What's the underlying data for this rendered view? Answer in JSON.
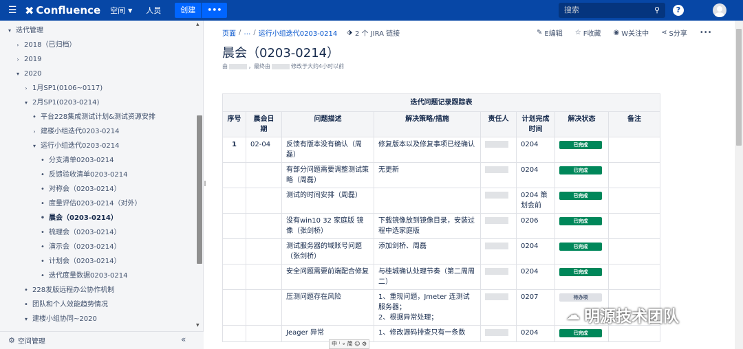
{
  "header": {
    "app_name": "Confluence",
    "nav_spaces": "空间",
    "nav_people": "人员",
    "create_label": "创建",
    "more_label": "•••",
    "search_placeholder": "搜索",
    "help_label": "?"
  },
  "sidebar": {
    "items": [
      {
        "label": "迭代管理",
        "level": 0,
        "expander": "▾"
      },
      {
        "label": "2018（已归档）",
        "level": 1,
        "expander": "›"
      },
      {
        "label": "2019",
        "level": 1,
        "expander": "›"
      },
      {
        "label": "2020",
        "level": 1,
        "expander": "▾"
      },
      {
        "label": "1月SP1(0106~0117)",
        "level": 2,
        "expander": "›"
      },
      {
        "label": "2月SP1(0203-0214)",
        "level": 2,
        "expander": "▾"
      },
      {
        "label": "平台228集成测试计划&测试资源安排",
        "level": 3,
        "expander": "•"
      },
      {
        "label": "建楼小组迭代0203-0214",
        "level": 3,
        "expander": "›"
      },
      {
        "label": "运行小组迭代0203-0214",
        "level": 3,
        "expander": "▾"
      },
      {
        "label": "分支清单0203-0214",
        "level": 4,
        "expander": "•"
      },
      {
        "label": "反馈验收清单0203-0214",
        "level": 4,
        "expander": "•"
      },
      {
        "label": "对称会（0203-0214）",
        "level": 4,
        "expander": "•"
      },
      {
        "label": "度量评估0203-0214（对外）",
        "level": 4,
        "expander": "•"
      },
      {
        "label": "晨会（0203-0214）",
        "level": 4,
        "expander": "•",
        "active": true
      },
      {
        "label": "梳理会（0203-0214）",
        "level": 4,
        "expander": "•"
      },
      {
        "label": "演示会（0203-0214）",
        "level": 4,
        "expander": "•"
      },
      {
        "label": "计划会（0203-0214）",
        "level": 4,
        "expander": "•"
      },
      {
        "label": "迭代度量数据0203-0214",
        "level": 4,
        "expander": "•"
      },
      {
        "label": "228发版远程办公协作机制",
        "level": 2,
        "expander": "•"
      },
      {
        "label": "团队和个人效能趋势情况",
        "level": 2,
        "expander": "•"
      },
      {
        "label": "建楼小组协同~2020",
        "level": 2,
        "expander": "▾"
      }
    ],
    "footer_label": "空间管理",
    "collapse_label": "«"
  },
  "breadcrumb": {
    "root": "页面",
    "ellipsis": "…",
    "parent": "运行小组迭代0203-0214",
    "jira": "2 个 JIRA 链接"
  },
  "actions": {
    "edit": "E编辑",
    "favorite": "F收藏",
    "watch": "W关注中",
    "share": "S分享",
    "more": "•••"
  },
  "page": {
    "title": "晨会（0203-0214）",
    "meta_by": "由",
    "meta_mid": "，最终由",
    "meta_end": "修改于大约4小时以前"
  },
  "table": {
    "caption": "迭代问题记录跟踪表",
    "headers": [
      "序号",
      "晨会日期",
      "问题描述",
      "解决策略/措施",
      "责任人",
      "计划完成时间",
      "解决状态",
      "备注"
    ],
    "rows": [
      {
        "no": "1",
        "date": "02-04",
        "desc": "反馈有版本没有确认（周磊）",
        "strategy": "修复版本以及修复事项已经确认",
        "due": "0204",
        "status": "已完成",
        "status_type": "done"
      },
      {
        "no": "",
        "date": "",
        "desc": "有部分问题需要调整测试策略（周磊）",
        "strategy": "无更新",
        "due": "0204",
        "status": "已完成",
        "status_type": "done"
      },
      {
        "no": "",
        "date": "",
        "desc": "测试的时间安排（周磊）",
        "strategy": "",
        "due": "0204 策划会前",
        "status": "已完成",
        "status_type": "done"
      },
      {
        "no": "",
        "date": "",
        "desc": "没有win10 32 家庭版 镜像（张剑桥）",
        "strategy": "下载镜像放到镜像目录，安装过程中选家庭版",
        "due": "0206",
        "status": "已完成",
        "status_type": "done"
      },
      {
        "no": "",
        "date": "",
        "desc": "测试服务器的域账号问题（张剑桥）",
        "strategy": "添加剑桥、周磊",
        "due": "0204",
        "status": "已完成",
        "status_type": "done"
      },
      {
        "no": "",
        "date": "",
        "desc": "安全问题需要前端配合修复",
        "strategy": "与桂城确认处理节奏（第二周周二）",
        "due": "0204",
        "status": "已完成",
        "status_type": "done"
      },
      {
        "no": "",
        "date": "",
        "desc": "压测问题存在风险",
        "strategy": "1、重现问题，Jmeter 连测试服务器；\n2、根据异常处理；",
        "due": "0207",
        "status": "待办项",
        "status_type": "pending"
      },
      {
        "no": "",
        "date": "",
        "desc": "Jeager 异常",
        "strategy": "1、修改源码排查只有一条数",
        "due": "0204",
        "status": "已完成",
        "status_type": "done"
      }
    ]
  },
  "watermark": "明源技术团队",
  "ime": "中 ⁾ ∘ 简 ☺ ⚙"
}
